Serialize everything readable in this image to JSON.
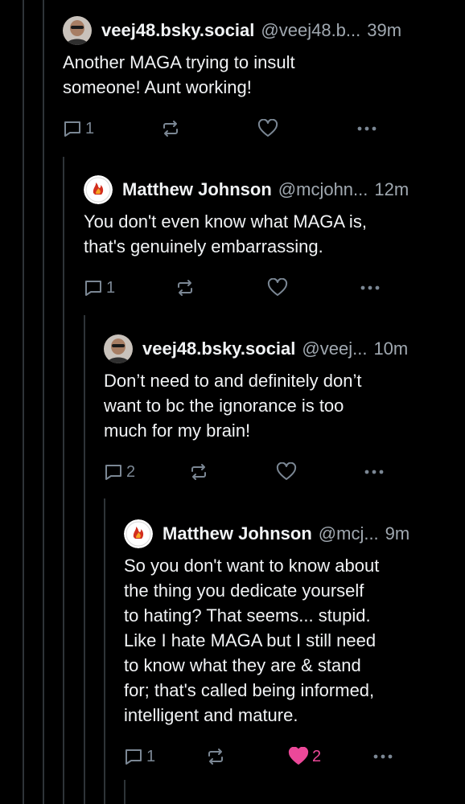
{
  "thread": {
    "posts": [
      {
        "name": "veej48.bsky.social",
        "handle": "@veej48.b...",
        "time": "39m",
        "text": "Another MAGA trying to insult\nsomeone! Aunt working!",
        "reply_count": "1",
        "like_count": "",
        "avatar": "person-avatar-icon"
      },
      {
        "name": "Matthew Johnson",
        "handle": "@mcjohn...",
        "time": "12m",
        "text": "You don't even know what MAGA is,\nthat's genuinely embarrassing.",
        "reply_count": "1",
        "like_count": "",
        "avatar": "flames-logo-avatar-icon"
      },
      {
        "name": "veej48.bsky.social",
        "handle": "@veej...",
        "time": "10m",
        "text": "Don’t need to and definitely don’t\nwant to bc the ignorance is too\nmuch for my brain!",
        "reply_count": "2",
        "like_count": "",
        "avatar": "person-avatar-icon"
      },
      {
        "name": "Matthew Johnson",
        "handle": "@mcj...",
        "time": "9m",
        "text": "So you don't want to know about\nthe thing you dedicate yourself\nto hating? That seems... stupid.\nLike I hate MAGA but I still need\nto know what they are & stand\nfor; that's called being informed,\nintelligent and mature.",
        "reply_count": "1",
        "like_count": "2",
        "liked": true,
        "avatar": "flames-logo-avatar-icon"
      }
    ]
  },
  "colors": {
    "background": "#000000",
    "text": "#f1f3f5",
    "muted": "#a0a8b0",
    "icon": "#7b8794",
    "like_active": "#ec4899",
    "thread_line": "#2e3438"
  }
}
